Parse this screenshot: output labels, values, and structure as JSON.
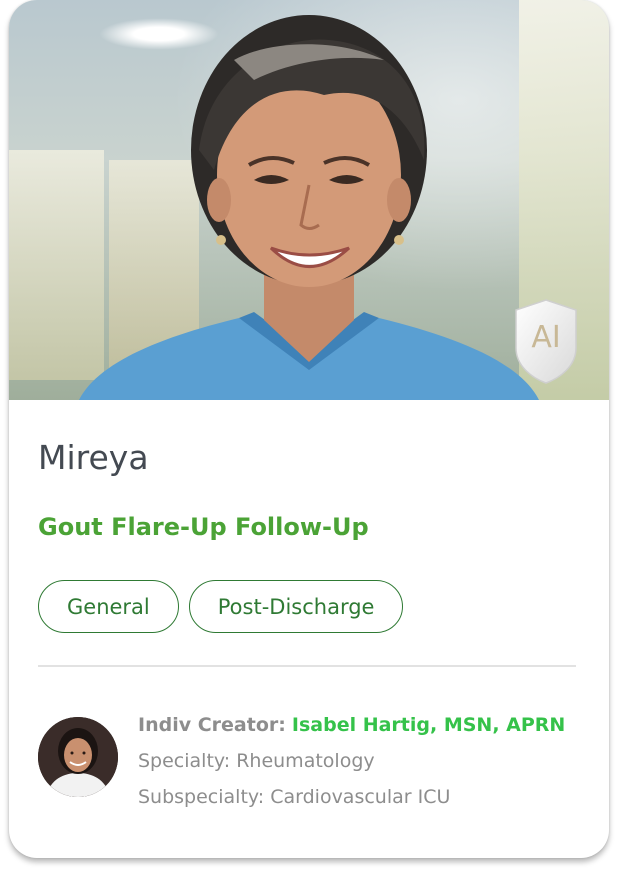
{
  "card": {
    "name": "Mireya",
    "scenario_title": "Gout Flare-Up Follow-Up",
    "badge_label": "AI",
    "tags": [
      "General",
      "Post-Discharge"
    ],
    "creator": {
      "label": "Indiv Creator:",
      "name": "Isabel Hartig, MSN, APRN",
      "specialty": "Specialty: Rheumatology",
      "subspecialty": "Subspecialty: Cardiovascular ICU"
    }
  },
  "colors": {
    "accent_green": "#4ba336",
    "creator_green": "#35c24a",
    "tag_border": "#2f7a34",
    "name_text": "#444a52",
    "muted_text": "#8d8d8d",
    "scrubs_blue": "#5a9fd2"
  },
  "icons": {
    "badge": "ai-shield-icon",
    "hero": "portrait-photo",
    "avatar": "creator-avatar-photo"
  }
}
